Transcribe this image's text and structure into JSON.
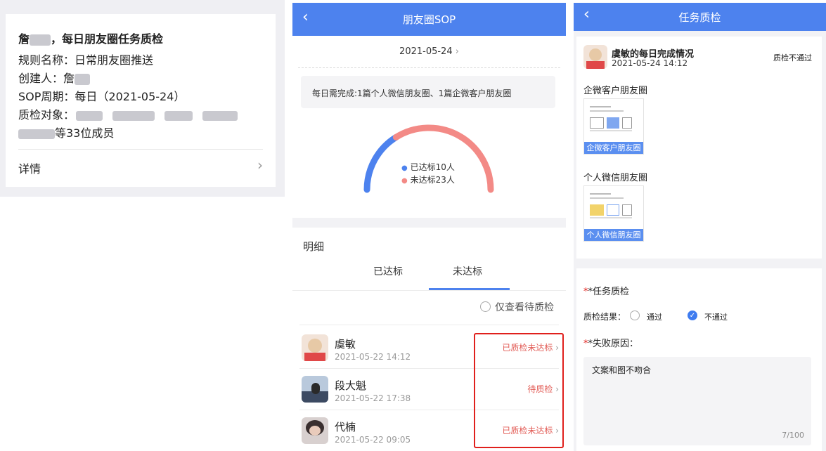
{
  "panel1": {
    "title_suffix": "，每日朋友圈任务质检",
    "title_prefix": "詹",
    "rule_name": "规则名称：日常朋友圈推送",
    "creator": "创建人：詹",
    "sop_cycle": "SOP周期：每日（2021-05-24）",
    "target_label": "质检对象：",
    "member_suffix": "等33位成员",
    "detail_label": "详情"
  },
  "panel2": {
    "header_title": "朋友圈SOP",
    "date": "2021-05-24",
    "requirement": "每日需完成:1篇个人微信朋友圈、1篇企微客户朋友圈",
    "legend_met": "已达标10人",
    "legend_unmet": "未达标23人",
    "color_met": "#4d82ee",
    "color_unmet": "#f38a86",
    "section_title": "明细",
    "tabs": [
      "已达标",
      "未达标"
    ],
    "active_tab": "未达标",
    "filter_label": "仅查看待质检",
    "rows": [
      {
        "name": "虞敏",
        "time": "2021-05-22 14:12",
        "status": "已质检未达标"
      },
      {
        "name": "段大魁",
        "time": "2021-05-22 17:38",
        "status": "待质检"
      },
      {
        "name": "代楠",
        "time": "2021-05-22 09:05",
        "status": "已质检未达标"
      }
    ]
  },
  "panel3": {
    "header_title": "任务质检",
    "record_title": "虞敏的每日完成情况",
    "record_time": "2021-05-24 14:12",
    "record_status": "质检不通过",
    "section1": "企微客户朋友圈",
    "thumb1_caption": "企微客户朋友圈",
    "section2": "个人微信朋友圈",
    "thumb2_caption": "个人微信朋友圈",
    "qc_title": "*任务质检",
    "result_label": "质检结果：",
    "option_pass": "通过",
    "option_fail": "不通过",
    "selected_option": "不通过",
    "reason_label": "*失败原因：",
    "reason_text": "文案和图不吻合",
    "char_count": "7/100"
  }
}
